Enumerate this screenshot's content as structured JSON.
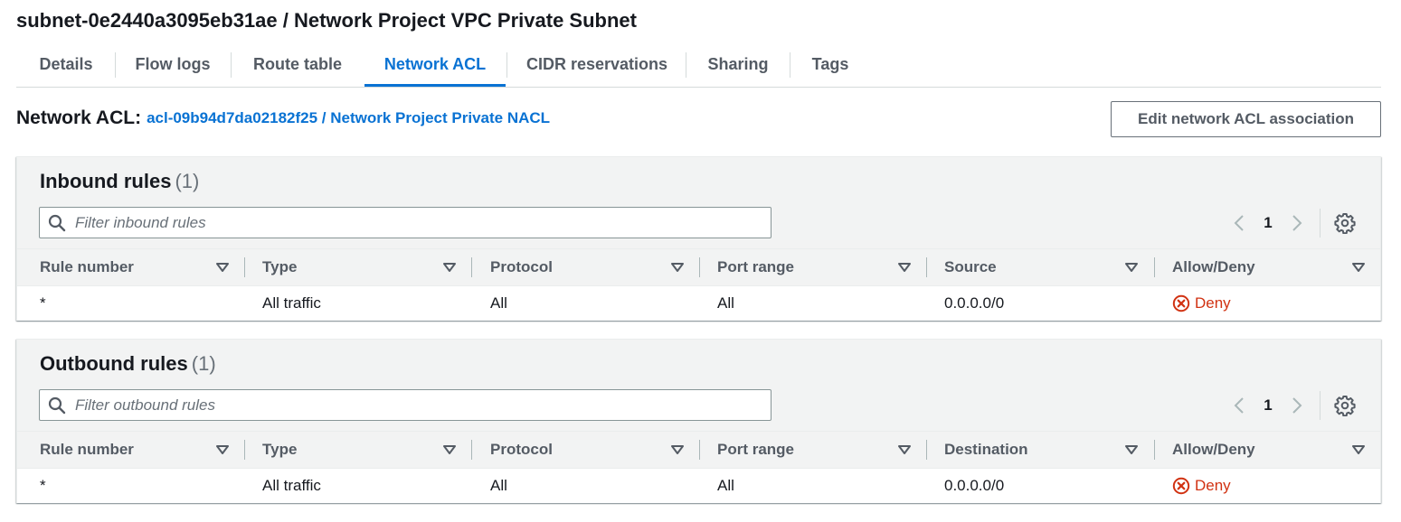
{
  "page": {
    "title": "subnet-0e2440a3095eb31ae / Network Project VPC Private Subnet"
  },
  "tabs": [
    {
      "label": "Details"
    },
    {
      "label": "Flow logs"
    },
    {
      "label": "Route table"
    },
    {
      "label": "Network ACL",
      "active": true
    },
    {
      "label": "CIDR reservations"
    },
    {
      "label": "Sharing"
    },
    {
      "label": "Tags"
    }
  ],
  "network_acl": {
    "label": "Network ACL:",
    "link_text": "acl-09b94d7da02182f25 / Network Project Private NACL",
    "edit_button_label": "Edit network ACL association"
  },
  "inbound": {
    "title": "Inbound rules",
    "count": "(1)",
    "filter_placeholder": "Filter inbound rules",
    "filter_value": "",
    "current_page": "1",
    "columns": [
      "Rule number",
      "Type",
      "Protocol",
      "Port range",
      "Source",
      "Allow/Deny"
    ],
    "rows": [
      {
        "rule_number": "*",
        "type": "All traffic",
        "protocol": "All",
        "port_range": "All",
        "address": "0.0.0.0/0",
        "action": "Deny"
      }
    ]
  },
  "outbound": {
    "title": "Outbound rules",
    "count": "(1)",
    "filter_placeholder": "Filter outbound rules",
    "filter_value": "",
    "current_page": "1",
    "columns": [
      "Rule number",
      "Type",
      "Protocol",
      "Port range",
      "Destination",
      "Allow/Deny"
    ],
    "rows": [
      {
        "rule_number": "*",
        "type": "All traffic",
        "protocol": "All",
        "port_range": "All",
        "address": "0.0.0.0/0",
        "action": "Deny"
      }
    ]
  },
  "colors": {
    "link": "#0972d3",
    "deny": "#d13212",
    "panel_bg": "#f2f3f3"
  },
  "icons": {
    "filter": "search-icon",
    "prev": "chevron-left-icon",
    "next": "chevron-right-icon",
    "settings": "gear-icon",
    "sort": "caret-down-icon",
    "deny": "x-circle-icon"
  }
}
